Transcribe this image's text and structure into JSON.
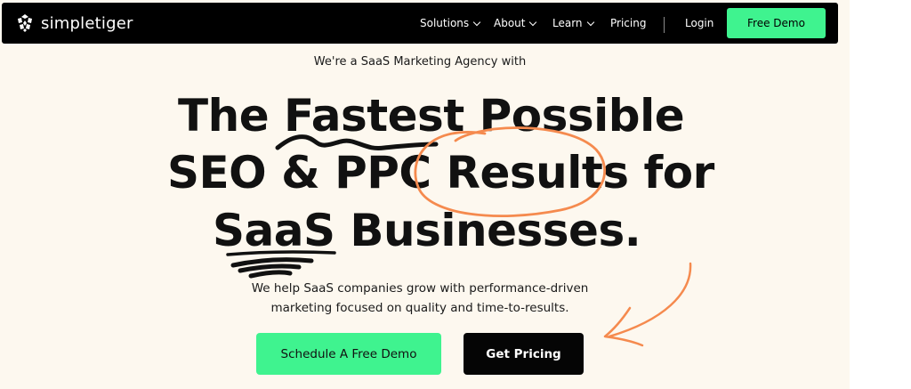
{
  "brand": {
    "name": "simpletiger",
    "logo_icon": "tiger-head-icon"
  },
  "nav": {
    "items": [
      {
        "label": "Solutions",
        "has_dropdown": true
      },
      {
        "label": "About",
        "has_dropdown": true
      },
      {
        "label": "Learn",
        "has_dropdown": true
      },
      {
        "label": "Pricing",
        "has_dropdown": false
      }
    ],
    "login_label": "Login",
    "demo_label": "Free Demo"
  },
  "hero": {
    "eyebrow": "We're a SaaS Marketing Agency with",
    "headline": {
      "line1": "The Fastest Possible",
      "line2_a": "SEO & PPC ",
      "line2_b": "Results",
      "line2_c": " for",
      "line3_a": "SaaS",
      "line3_b": " Businesses."
    },
    "subtext_line1": "We help SaaS companies grow with performance-driven",
    "subtext_line2": "marketing focused on quality and time-to-results.",
    "cta_primary": "Schedule A Free Demo",
    "cta_secondary": "Get Pricing"
  },
  "colors": {
    "accent_green": "#3ff38f",
    "nav_bg": "#000000",
    "hero_bg": "#fdf8ef",
    "scribble_orange": "#f58a4e",
    "scribble_black": "#111111"
  }
}
